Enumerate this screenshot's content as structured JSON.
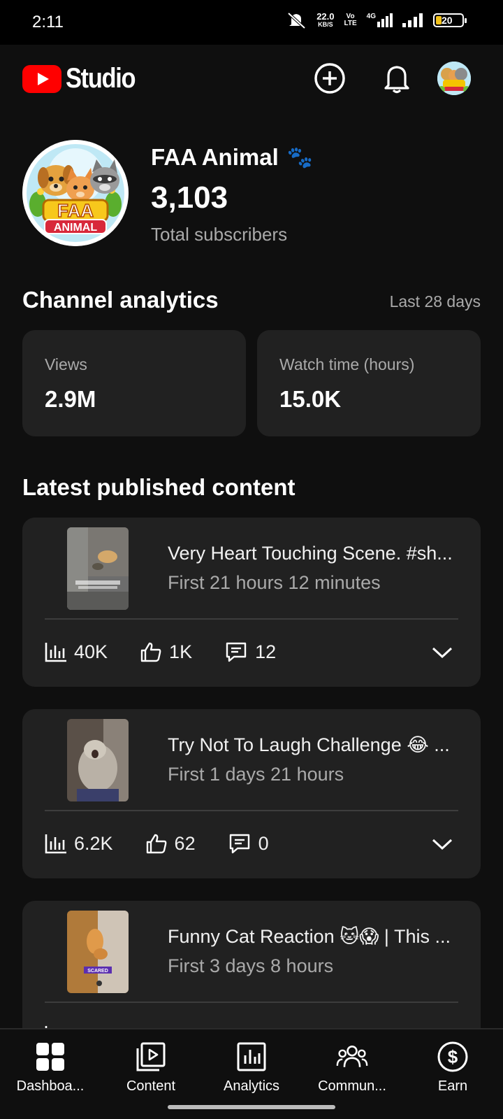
{
  "status_bar": {
    "time": "2:11",
    "net_speed": "22.0",
    "net_unit": "KB/S",
    "volte_top": "Vo",
    "volte_bottom": "LTE",
    "network": "4G",
    "battery": "20"
  },
  "app": {
    "name": "Studio",
    "create_icon": "add-circle-icon",
    "notifications_icon": "bell-icon"
  },
  "channel": {
    "name": "FAA Animal",
    "emoji": "🐾",
    "subscriber_count": "3,103",
    "subscriber_label": "Total subscribers",
    "avatar_text_top": "FAA",
    "avatar_text_bottom": "ANIMAL"
  },
  "analytics": {
    "title": "Channel analytics",
    "range": "Last 28 days",
    "stats": [
      {
        "label": "Views",
        "value": "2.9M"
      },
      {
        "label": "Watch time (hours)",
        "value": "15.0K"
      }
    ]
  },
  "latest": {
    "title": "Latest published content",
    "items": [
      {
        "title": "Very Heart Touching Scene. #sh...",
        "subtitle": "First 21 hours 12 minutes",
        "views": "40K",
        "likes": "1K",
        "comments": "12"
      },
      {
        "title": "Try Not To Laugh Challenge 😂 ...",
        "subtitle": "First 1 days 21 hours",
        "views": "6.2K",
        "likes": "62",
        "comments": "0"
      },
      {
        "title": "Funny Cat Reaction 🐱😱 | This ...",
        "subtitle": "First 3 days 8 hours",
        "thumb_caption": "SCARED"
      }
    ]
  },
  "bottom_nav": [
    {
      "label": "Dashboa...",
      "icon": "dashboard-icon"
    },
    {
      "label": "Content",
      "icon": "content-icon"
    },
    {
      "label": "Analytics",
      "icon": "analytics-icon"
    },
    {
      "label": "Commun...",
      "icon": "community-icon"
    },
    {
      "label": "Earn",
      "icon": "earn-icon"
    }
  ],
  "colors": {
    "background": "#0f0f0f",
    "card": "#212121",
    "brand_red": "#ff0000",
    "secondary_text": "#aaaaaa"
  }
}
